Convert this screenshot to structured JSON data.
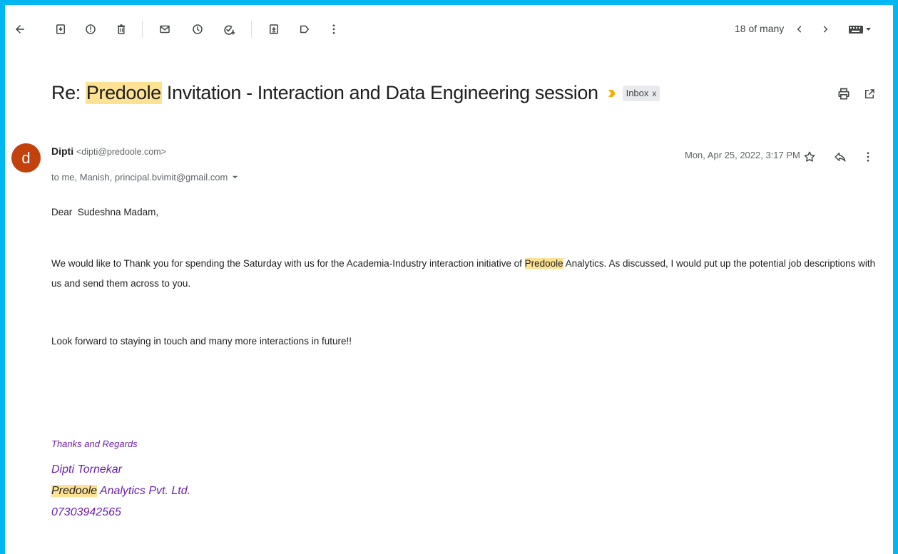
{
  "toolbar": {
    "counter": "18 of many"
  },
  "email": {
    "subject_prefix": "Re: ",
    "subject_highlight": "Predoole",
    "subject_rest": " Invitation - Interaction and Data Engineering session",
    "label_chip": "Inbox",
    "label_chip_close": "x",
    "avatar_letter": "d",
    "sender_name": "Dipti",
    "sender_email": "<dipti@predoole.com>",
    "recipients": "to me, Manish, principal.bvimit@gmail.com",
    "date": "Mon, Apr 25, 2022, 3:17 PM",
    "greeting": "Dear  Sudeshna Madam,",
    "para1_before": "We would like to Thank you for spending the Saturday with us for the Academia-Industry interaction initiative of ",
    "para1_highlight": "Predoole",
    "para1_after": " Analytics. As discussed, I would put up the potential job descriptions with us and send them across to you.",
    "para2": "Look forward to staying in touch and many more interactions in future!!",
    "sig_regards": "Thanks and Regards",
    "sig_name": "Dipti Tornekar",
    "sig_company_highlight": "Predoole",
    "sig_company_rest": " Analytics Pvt. Ltd.",
    "sig_phone": "07303942565"
  },
  "colors": {
    "frame": "#00b7f1",
    "highlight": "#fde293",
    "avatar": "#c2410c",
    "signature": "#6b21a8",
    "importance": "#f9ab00"
  }
}
